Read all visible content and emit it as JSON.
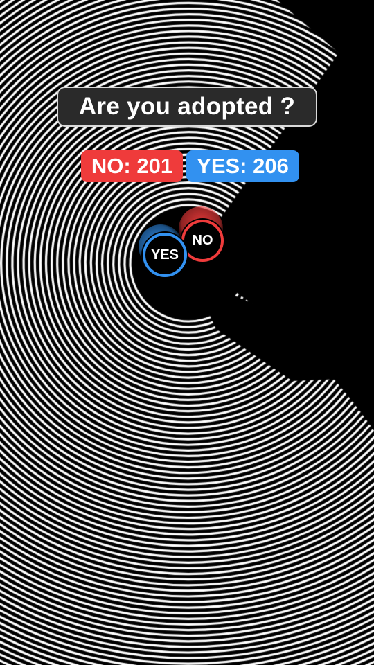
{
  "question": "Are you adopted ?",
  "scoreboard": {
    "no": {
      "text": "NO: 201",
      "label": "NO",
      "count": 201,
      "color": "#ef3b3b"
    },
    "yes": {
      "text": "YES: 206",
      "label": "YES",
      "count": 206,
      "color": "#3291f0"
    }
  },
  "balls": {
    "no": {
      "label": "NO",
      "color": "#ef3b3b"
    },
    "yes": {
      "label": "YES",
      "color": "#3291f0"
    }
  },
  "arena": {
    "background": "#000000",
    "ring_color": "#ffffff",
    "gap_direction": "lower-right"
  }
}
